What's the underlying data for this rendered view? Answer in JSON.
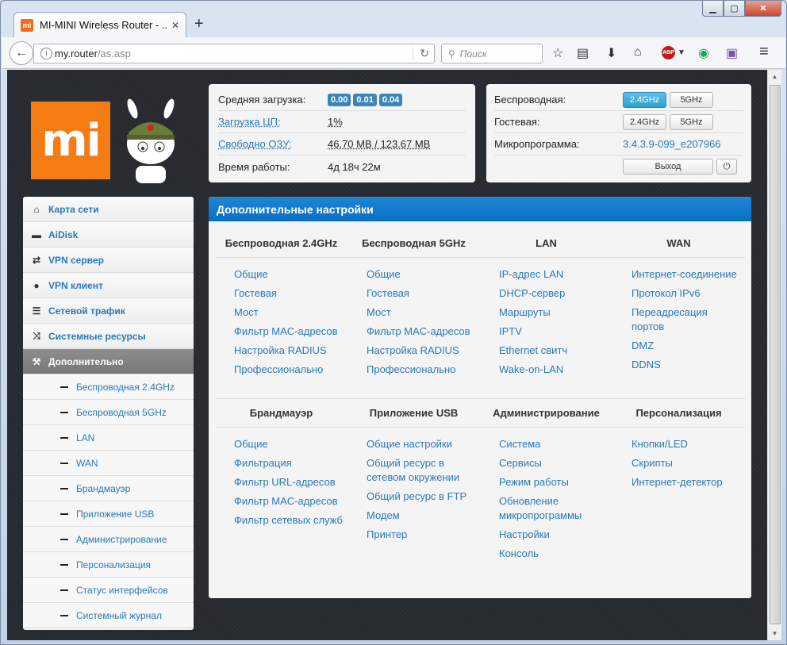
{
  "browser": {
    "tab_title": "MI-MINI Wireless Router - ...",
    "url_host": "my.router",
    "url_path": "/as.asp",
    "search_placeholder": "Поиск"
  },
  "status": {
    "load_label": "Средняя загрузка:",
    "load_values": [
      "0.00",
      "0.01",
      "0.04"
    ],
    "cpu_label": "Загрузка ЦП:",
    "cpu_value": "1%",
    "ram_label": "Свободно ОЗУ:",
    "ram_value": "46.70 MB / 123.67 MB",
    "uptime_label": "Время работы:",
    "uptime_value": "4д 18ч 22м"
  },
  "wireless": {
    "wifi_label": "Беспроводная:",
    "guest_label": "Гостевая:",
    "fw_label": "Микропрограмма:",
    "fw_value": "3.4.3.9-099_e207966",
    "b24": "2.4GHz",
    "b5": "5GHz",
    "logout": "Выход"
  },
  "logo_text": "mi",
  "sidebar": {
    "items": [
      {
        "label": "Карта сети",
        "icon": "home-icon",
        "glyph": "⌂"
      },
      {
        "label": "AiDisk",
        "icon": "disk-icon",
        "glyph": "▬"
      },
      {
        "label": "VPN сервер",
        "icon": "vpn-server-icon",
        "glyph": "⇄"
      },
      {
        "label": "VPN клиент",
        "icon": "globe-icon",
        "glyph": "●"
      },
      {
        "label": "Сетевой трафик",
        "icon": "traffic-icon",
        "glyph": "☰"
      },
      {
        "label": "Системные ресурсы",
        "icon": "shuffle-icon",
        "glyph": "⤨"
      },
      {
        "label": "Дополнительно",
        "icon": "wrench-icon",
        "glyph": "⚒"
      }
    ],
    "subitems": [
      "Беспроводная 2.4GHz",
      "Беспроводная 5GHz",
      "LAN",
      "WAN",
      "Брандмауэр",
      "Приложение USB",
      "Администрирование",
      "Персонализация",
      "Статус интерфейсов",
      "Системный журнал"
    ]
  },
  "main": {
    "title": "Дополнительные настройки",
    "sections1": [
      {
        "title": "Беспроводная 2.4GHz",
        "links": [
          "Общие",
          "Гостевая",
          "Мост",
          "Фильтр MAC-адресов",
          "Настройка RADIUS",
          "Профессионально"
        ]
      },
      {
        "title": "Беспроводная 5GHz",
        "links": [
          "Общие",
          "Гостевая",
          "Мост",
          "Фильтр MAC-адресов",
          "Настройка RADIUS",
          "Профессионально"
        ]
      },
      {
        "title": "LAN",
        "links": [
          "IP-адрес LAN",
          "DHCP-сервер",
          "Маршруты",
          "IPTV",
          "Ethernet свитч",
          "Wake-on-LAN"
        ]
      },
      {
        "title": "WAN",
        "links": [
          "Интернет-соединение",
          "Протокол IPv6",
          "Переадресация портов",
          "DMZ",
          "DDNS"
        ]
      }
    ],
    "sections2": [
      {
        "title": "Брандмауэр",
        "links": [
          "Общие",
          "Фильтрация",
          "Фильтр URL-адресов",
          "Фильтр MAC-адресов",
          "Фильтр сетевых служб"
        ]
      },
      {
        "title": "Приложение USB",
        "links": [
          "Общие настройки",
          "Общий ресурс в сетевом окружении",
          "Общий ресурс в FTP",
          "Модем",
          "Принтер"
        ]
      },
      {
        "title": "Администрирование",
        "links": [
          "Система",
          "Сервисы",
          "Режим работы",
          "Обновление микропрограммы",
          "Настройки",
          "Консоль"
        ]
      },
      {
        "title": "Персонализация",
        "links": [
          "Кнопки/LED",
          "Скрипты",
          "Интернет-детектор"
        ]
      }
    ]
  }
}
